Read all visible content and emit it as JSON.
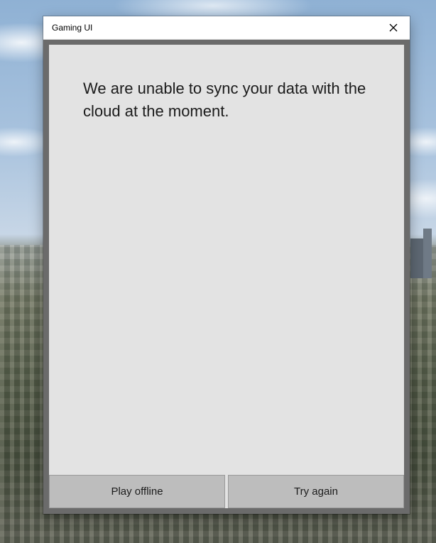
{
  "window": {
    "title": "Gaming UI",
    "close_icon": "close-icon"
  },
  "dialog": {
    "message": "We are unable to sync your data with the cloud at the moment.",
    "buttons": {
      "play_offline": "Play offline",
      "try_again": "Try again"
    }
  },
  "colors": {
    "content_bg": "#e3e3e3",
    "frame": "#6b6b6b",
    "button_bg": "#bdbdbd",
    "titlebar_bg": "#ffffff"
  }
}
